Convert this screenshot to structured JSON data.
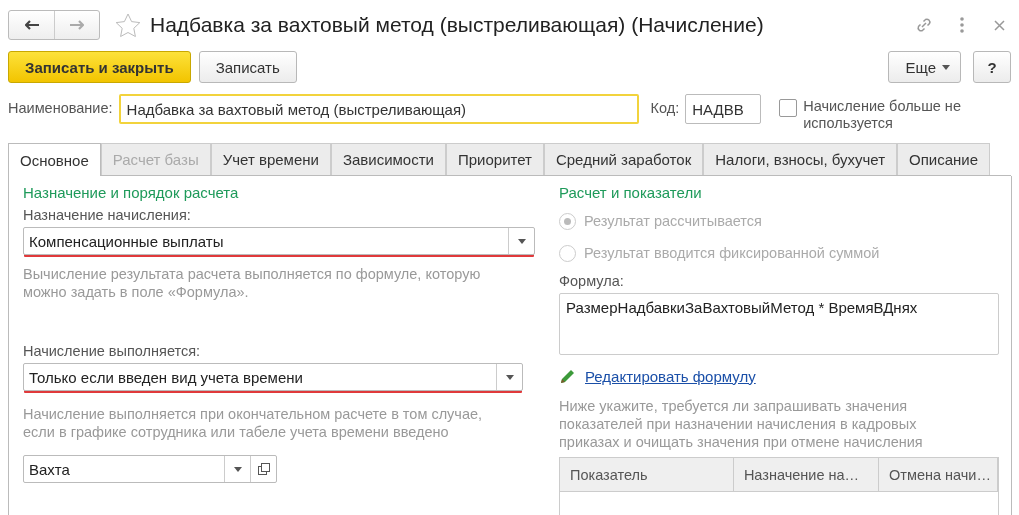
{
  "window": {
    "title": "Надбавка за вахтовый метод (выстреливающая) (Начисление)",
    "favorite": false
  },
  "toolbar": {
    "buttons": [
      {
        "label": "Записать и закрыть",
        "kind": "primary"
      },
      {
        "label": "Записать",
        "kind": "default"
      }
    ],
    "more": "Еще",
    "help": "?"
  },
  "header_fields": {
    "name": {
      "label": "Наименование:",
      "value": "Надбавка за вахтовый метод (выстреливающая)"
    },
    "code": {
      "label": "Код:",
      "value": "НАДВВ"
    },
    "not_used": {
      "label": "Начисление больше не используется",
      "checked": false
    }
  },
  "tabs": [
    {
      "label": "Основное",
      "selected": true,
      "disabled": false
    },
    {
      "label": "Расчет базы",
      "selected": false,
      "disabled": true
    },
    {
      "label": "Учет времени",
      "selected": false,
      "disabled": false
    },
    {
      "label": "Зависимости",
      "selected": false,
      "disabled": false
    },
    {
      "label": "Приоритет",
      "selected": false,
      "disabled": false
    },
    {
      "label": "Средний заработок",
      "selected": false,
      "disabled": false
    },
    {
      "label": "Налоги, взносы, бухучет",
      "selected": false,
      "disabled": false
    },
    {
      "label": "Описание",
      "selected": false,
      "disabled": false
    }
  ],
  "left": {
    "section_title": "Назначение и порядок расчета",
    "purpose": {
      "label": "Назначение начисления:",
      "value": "Компенсационные выплаты",
      "hint": "Вычисление результата расчета выполняется по формуле, которую можно задать в поле «Формула»."
    },
    "execution": {
      "label": "Начисление выполняется:",
      "value": "Только если введен вид учета времени",
      "hint": "Начисление выполняется при окончательном расчете в том случае, если в графике сотрудника или табеле учета времени введено"
    },
    "time_type": {
      "value": "Вахта"
    }
  },
  "right": {
    "section_title": "Расчет и показатели",
    "result_mode": [
      {
        "label": "Результат рассчитывается",
        "selected": true,
        "disabled": true
      },
      {
        "label": "Результат вводится фиксированной суммой",
        "selected": false,
        "disabled": true
      }
    ],
    "formula": {
      "label": "Формула:",
      "value": "РазмерНадбавкиЗаВахтовыйМетод * ВремяВДнях"
    },
    "edit_link": "Редактировать формулу",
    "indicators_hint": "Ниже укажите, требуется ли запрашивать значения показателей при назначении начисления в кадровых приказах и очищать значения при отмене начисления",
    "indicators_table": {
      "columns": [
        "Показатель",
        "Назначение на…",
        "Отмена начи…"
      ]
    }
  }
}
